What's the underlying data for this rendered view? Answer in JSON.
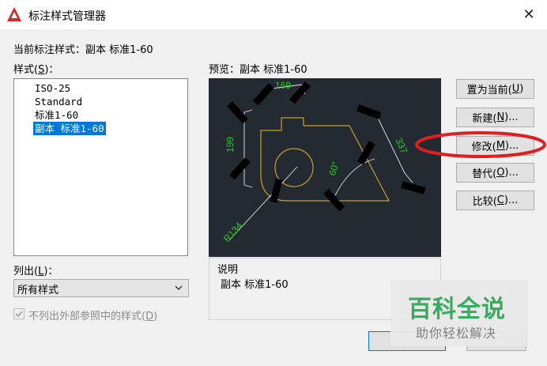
{
  "window": {
    "title": "标注样式管理器",
    "close_glyph": "✕"
  },
  "current_style": {
    "label": "当前标注样式：副本 标准1-60"
  },
  "styles": {
    "label_pre": "样式(",
    "label_key": "S",
    "label_post": ")：",
    "items": [
      "ISO-25",
      "Standard",
      "标准1-60",
      "副本 标准1-60"
    ],
    "selected_index": 3
  },
  "list_filter": {
    "label_pre": "列出(",
    "label_key": "L",
    "label_post": ")：",
    "value": "所有样式"
  },
  "xref_checkbox": {
    "label_pre": "不列出外部参照中的样式(",
    "label_key": "D",
    "label_post": ")",
    "checked": true,
    "enabled": false
  },
  "preview": {
    "label": "预览：副本 标准1-60",
    "dims": {
      "top": "169",
      "left": "199",
      "right": "337",
      "angle": "60°",
      "radius": "R134"
    },
    "colors": {
      "background": "#232a32",
      "outline": "#c8a12a",
      "dimension": "#22cc22",
      "grip": "#000000"
    }
  },
  "description": {
    "label": "说明",
    "text": "副本 标准1-60"
  },
  "buttons": [
    {
      "id": "set-current",
      "pre": "置为当前(",
      "key": "U",
      "post": ")"
    },
    {
      "id": "new",
      "pre": "新建(",
      "key": "N",
      "post": ")..."
    },
    {
      "id": "modify",
      "pre": "修改(",
      "key": "M",
      "post": ")..."
    },
    {
      "id": "override",
      "pre": "替代(",
      "key": "O",
      "post": ")..."
    },
    {
      "id": "compare",
      "pre": "比较(",
      "key": "C",
      "post": ")..."
    }
  ],
  "annotation": {
    "color": "#e02020"
  },
  "watermark": {
    "title": "百科全说",
    "subtitle": "助你轻松解决",
    "color": "#2aa654"
  }
}
